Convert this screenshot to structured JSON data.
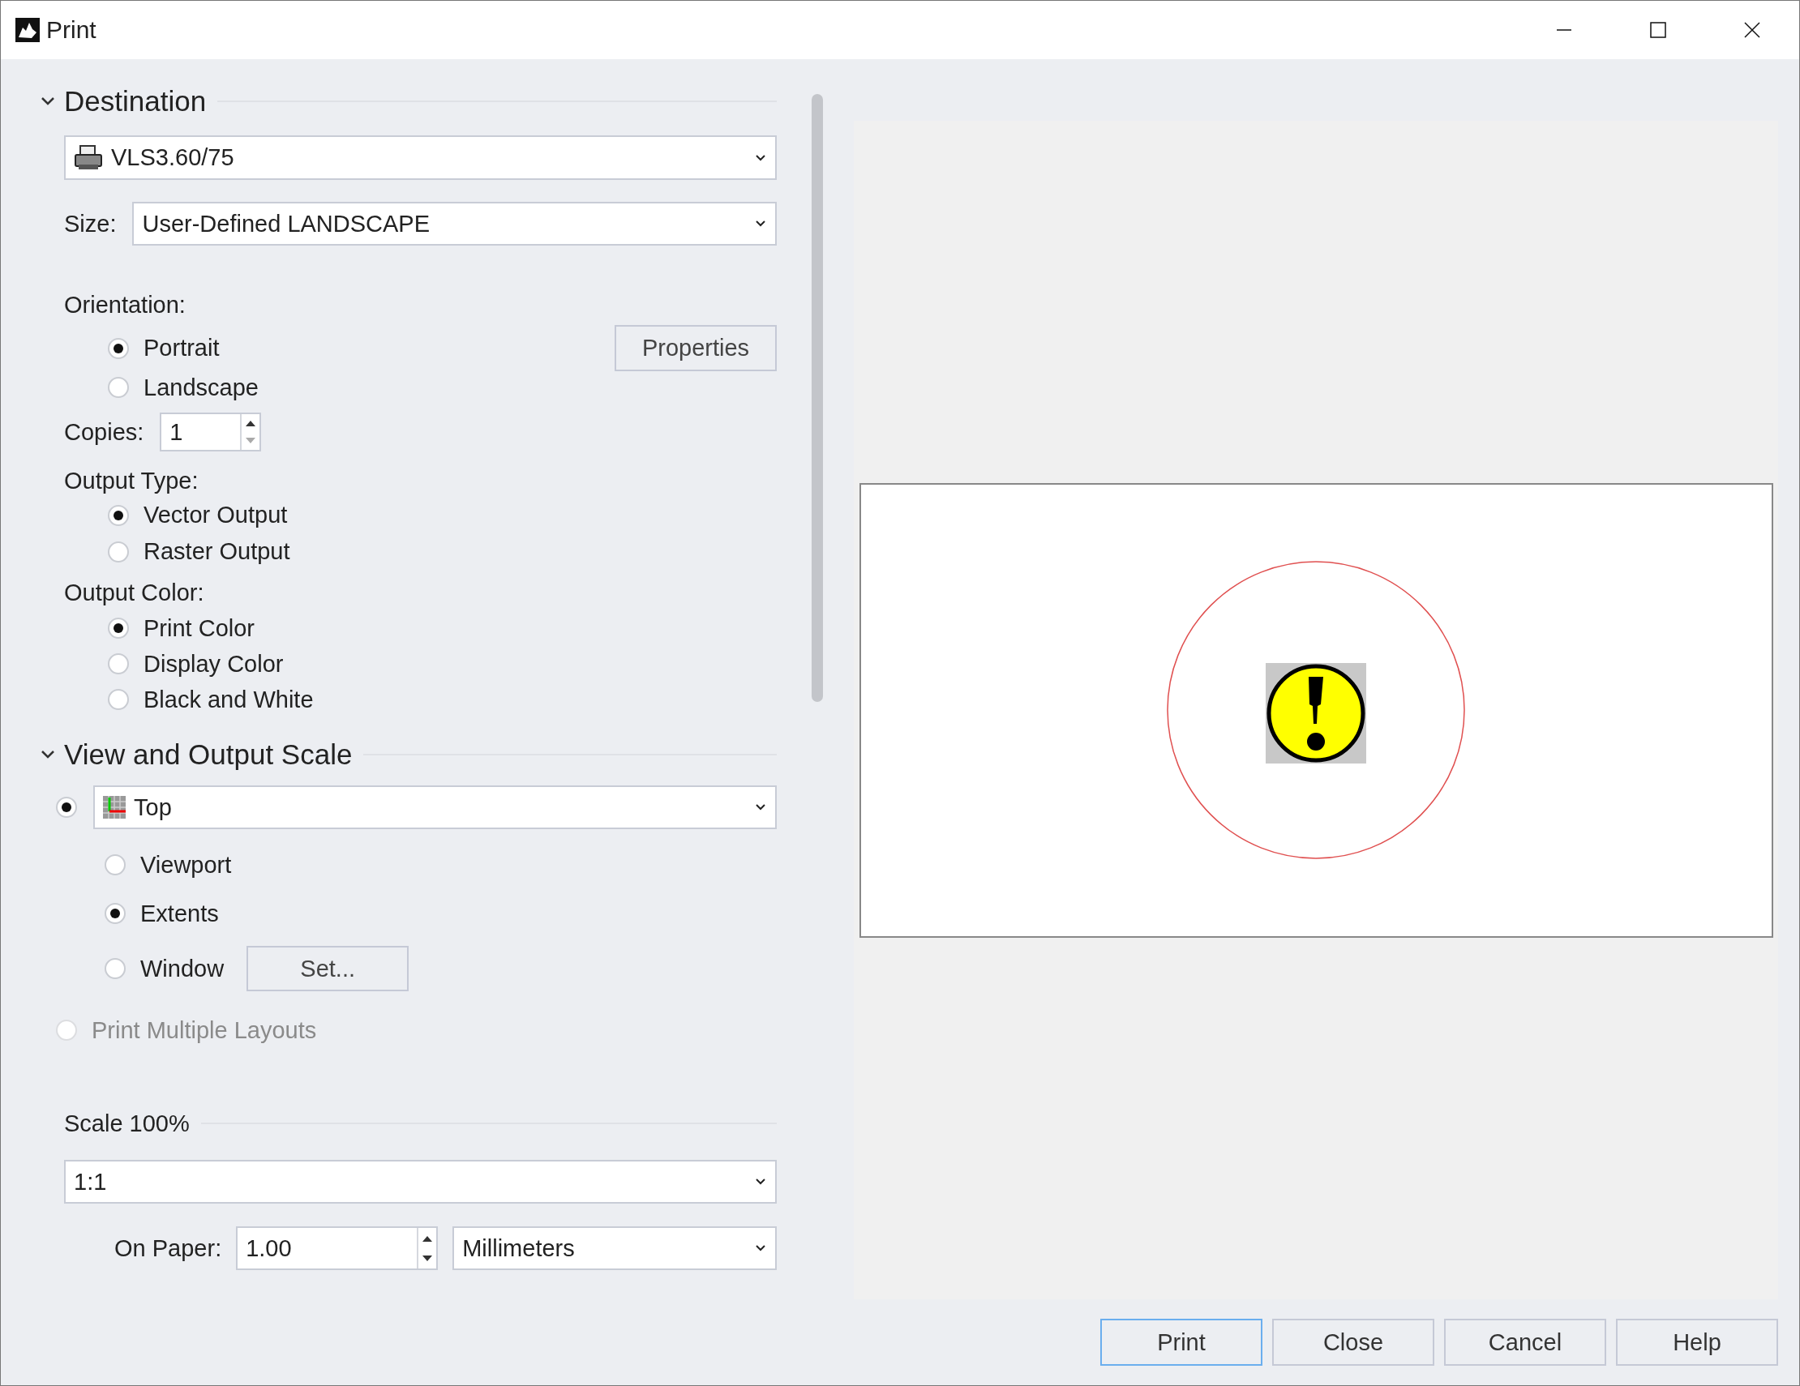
{
  "window": {
    "title": "Print"
  },
  "destination": {
    "title": "Destination",
    "expanded": true,
    "printer": "VLS3.60/75",
    "size_label": "Size:",
    "size": "User-Defined LANDSCAPE",
    "orientation_label": "Orientation:",
    "orientations": [
      {
        "label": "Portrait",
        "selected": true
      },
      {
        "label": "Landscape",
        "selected": false
      }
    ],
    "properties_button": "Properties",
    "copies_label": "Copies:",
    "copies": "1",
    "output_type_label": "Output Type:",
    "output_types": [
      {
        "label": "Vector Output",
        "selected": true
      },
      {
        "label": "Raster Output",
        "selected": false
      }
    ],
    "output_color_label": "Output Color:",
    "output_colors": [
      {
        "label": "Print Color",
        "selected": true
      },
      {
        "label": "Display Color",
        "selected": false
      },
      {
        "label": "Black and White",
        "selected": false
      }
    ]
  },
  "view_scale": {
    "title": "View and Output Scale",
    "expanded": true,
    "view": {
      "selected": true,
      "value": "Top"
    },
    "areas": [
      {
        "label": "Viewport",
        "selected": false
      },
      {
        "label": "Extents",
        "selected": true
      },
      {
        "label": "Window",
        "selected": false,
        "button": "Set..."
      }
    ],
    "multiple_layouts": {
      "label": "Print Multiple Layouts",
      "selected": false,
      "disabled": true
    }
  },
  "scale": {
    "title": "Scale 100%",
    "ratio": "1:1",
    "on_paper_label": "On Paper:",
    "on_paper": "1.00",
    "units": "Millimeters"
  },
  "buttons": [
    {
      "label": "Print",
      "focused": true
    },
    {
      "label": "Close",
      "focused": false
    },
    {
      "label": "Cancel",
      "focused": false
    },
    {
      "label": "Help",
      "focused": false
    }
  ]
}
